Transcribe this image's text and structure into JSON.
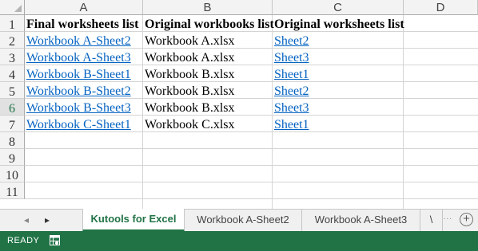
{
  "columns": [
    "A",
    "B",
    "C",
    "D"
  ],
  "row_numbers": [
    "1",
    "2",
    "3",
    "4",
    "5",
    "6",
    "7",
    "8",
    "9",
    "10",
    "11"
  ],
  "rows": [
    [
      "Final worksheets list",
      "Original workbooks list",
      "Original worksheets list"
    ],
    [
      "Workbook A-Sheet2",
      "Workbook A.xlsx",
      "Sheet2"
    ],
    [
      "Workbook A-Sheet3",
      "Workbook A.xlsx",
      "Sheet3"
    ],
    [
      "Workbook B-Sheet1",
      "Workbook B.xlsx",
      "Sheet1"
    ],
    [
      "Workbook B-Sheet2",
      "Workbook B.xlsx",
      "Sheet2"
    ],
    [
      "Workbook B-Sheet3",
      "Workbook B.xlsx",
      "Sheet3"
    ],
    [
      "Workbook C-Sheet1",
      "Workbook C.xlsx",
      "Sheet1"
    ]
  ],
  "selected_row": "6",
  "sheet_tabs": [
    "Kutools for Excel",
    "Workbook A-Sheet2",
    "Workbook A-Sheet3",
    "\\"
  ],
  "active_tab": "Kutools for Excel",
  "tab_nav": {
    "prev": "◂",
    "next": "▸",
    "more": "...",
    "add": "+"
  },
  "status": {
    "text": "READY"
  },
  "colors": {
    "link": "#0563c1",
    "excel_green": "#217346"
  },
  "icons": [
    "macro-record-icon",
    "add-sheet-icon"
  ]
}
